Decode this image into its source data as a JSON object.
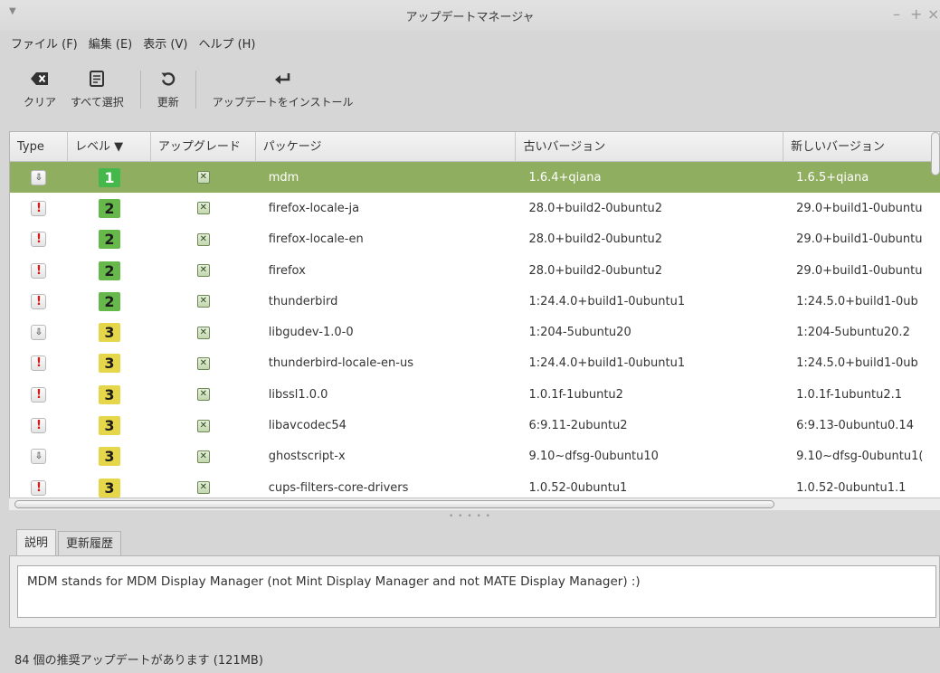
{
  "window": {
    "title": "アップデートマネージャ"
  },
  "menubar": [
    {
      "label": "ファイル (F)"
    },
    {
      "label": "編集 (E)"
    },
    {
      "label": "表示 (V)"
    },
    {
      "label": "ヘルプ (H)"
    }
  ],
  "toolbar": {
    "clear_label": "クリア",
    "select_all_label": "すべて選択",
    "refresh_label": "更新",
    "install_label": "アップデートをインストール"
  },
  "table": {
    "columns": [
      "Type",
      "レベル ▼",
      "アップグレード",
      "パッケージ",
      "古いバージョン",
      "新しいバージョン"
    ],
    "rows": [
      {
        "type": "package",
        "level": "1",
        "package": "mdm",
        "old": "1.6.4+qiana",
        "new": "1.6.5+qiana",
        "selected": true
      },
      {
        "type": "security",
        "level": "2",
        "package": "firefox-locale-ja",
        "old": "28.0+build2-0ubuntu2",
        "new": "29.0+build1-0ubuntu"
      },
      {
        "type": "security",
        "level": "2",
        "package": "firefox-locale-en",
        "old": "28.0+build2-0ubuntu2",
        "new": "29.0+build1-0ubuntu"
      },
      {
        "type": "security",
        "level": "2",
        "package": "firefox",
        "old": "28.0+build2-0ubuntu2",
        "new": "29.0+build1-0ubuntu"
      },
      {
        "type": "security",
        "level": "2",
        "package": "thunderbird",
        "old": "1:24.4.0+build1-0ubuntu1",
        "new": "1:24.5.0+build1-0ub"
      },
      {
        "type": "package",
        "level": "3",
        "package": "libgudev-1.0-0",
        "old": "1:204-5ubuntu20",
        "new": "1:204-5ubuntu20.2"
      },
      {
        "type": "security",
        "level": "3",
        "package": "thunderbird-locale-en-us",
        "old": "1:24.4.0+build1-0ubuntu1",
        "new": "1:24.5.0+build1-0ub"
      },
      {
        "type": "security",
        "level": "3",
        "package": "libssl1.0.0",
        "old": "1.0.1f-1ubuntu2",
        "new": "1.0.1f-1ubuntu2.1"
      },
      {
        "type": "security",
        "level": "3",
        "package": "libavcodec54",
        "old": "6:9.11-2ubuntu2",
        "new": "6:9.13-0ubuntu0.14"
      },
      {
        "type": "package",
        "level": "3",
        "package": "ghostscript-x",
        "old": "9.10~dfsg-0ubuntu10",
        "new": "9.10~dfsg-0ubuntu1("
      },
      {
        "type": "security",
        "level": "3",
        "package": "cups-filters-core-drivers",
        "old": "1.0.52-0ubuntu1",
        "new": "1.0.52-0ubuntu1.1"
      }
    ]
  },
  "tabs": [
    {
      "label": "説明"
    },
    {
      "label": "更新履歴"
    }
  ],
  "description": "MDM stands for MDM Display Manager (not Mint Display Manager and not MATE Display Manager) :)",
  "status": "84 個の推奨アップデートがあります (121MB)",
  "colors": {
    "selected_row": "#8fae60",
    "level1": "#44b84a",
    "level2": "#66b84a",
    "level3": "#e6d64a",
    "security_icon": "#d21b1b"
  }
}
